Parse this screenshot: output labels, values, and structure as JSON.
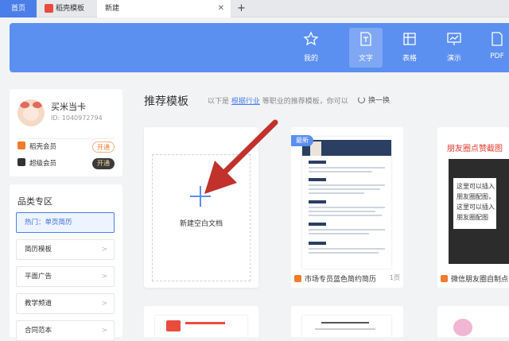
{
  "tabs": [
    {
      "label": "首页"
    },
    {
      "label": "稻壳模板"
    },
    {
      "label": "新建"
    }
  ],
  "tab_close": "✕",
  "tab_add": "+",
  "nav": {
    "mine": "我的",
    "text": "文字",
    "table": "表格",
    "show": "演示",
    "pdf": "PDF"
  },
  "user": {
    "name": "买米当卡",
    "id": "ID: 1040972794"
  },
  "members": [
    {
      "label": "稻壳会员",
      "button": "开通"
    },
    {
      "label": "超级会员",
      "button": "开通"
    }
  ],
  "category": {
    "title": "品类专区",
    "items": [
      "热门：单页简历",
      "简历模板",
      "平面广告",
      "教学频道",
      "合同范本"
    ]
  },
  "section": {
    "title": "推荐模板",
    "desc_prefix": "以下是",
    "desc_link": "根据行业",
    "desc_suffix": "等职业的推荐模板，你可以",
    "refresh": "换一换"
  },
  "new_doc": {
    "label": "新建空白文档"
  },
  "cards": [
    {
      "badge": "最新",
      "caption": "市场专员蓝色简约简历",
      "pages": "1页"
    },
    {
      "caption": "微信朋友圈自制点",
      "title": "朋友圈点赞截图",
      "bubble": "这里可以插入朋友圈配图，这里可以插入朋友圈配图"
    }
  ],
  "colors": {
    "accent": "#5b8ff0",
    "tab_active": "#4a7ee8",
    "arrow": "#c0322b",
    "resume_navy": "#2a3f61"
  }
}
